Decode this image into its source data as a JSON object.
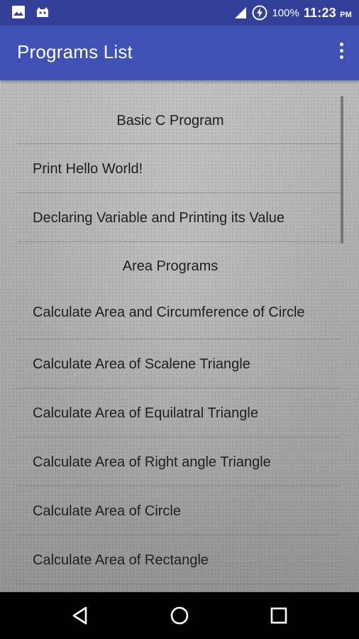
{
  "status_bar": {
    "left_icons": [
      "image-notification-icon",
      "android-notification-icon"
    ],
    "right_icons": [
      "signal-icon",
      "battery-charging-icon"
    ],
    "battery": "100%",
    "time": "11:23",
    "ampm": "PM"
  },
  "app_bar": {
    "title": "Programs List",
    "menu_icon": "more-vert-icon"
  },
  "list": {
    "sections": [
      {
        "header": "Basic C Program",
        "items": [
          "Print Hello World!",
          "Declaring Variable and Printing its Value"
        ]
      },
      {
        "header": "Area Programs",
        "items": [
          "Calculate Area and Circumference of Circle",
          "Calculate Area of Scalene Triangle",
          "Calculate Area of Equilatral Triangle",
          "Calculate Area of Right angle Triangle",
          "Calculate Area of Circle",
          "Calculate Area of Rectangle"
        ]
      }
    ]
  },
  "nav_bar": {
    "buttons": [
      "back-icon",
      "home-icon",
      "recents-icon"
    ]
  }
}
